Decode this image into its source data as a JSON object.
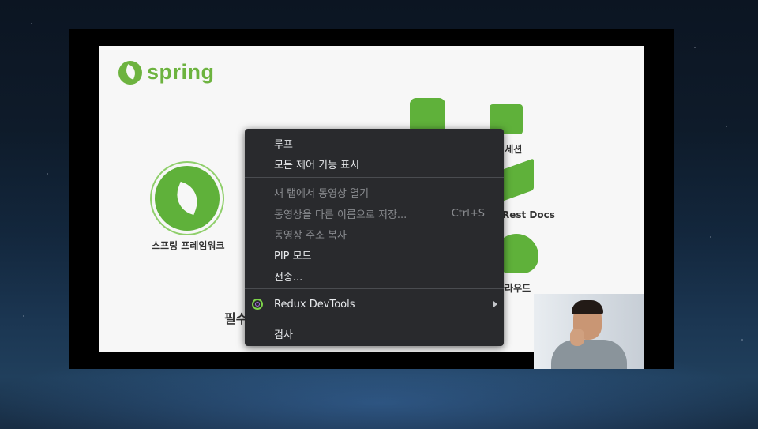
{
  "slide": {
    "logo_text": "spring",
    "framework_label": "스프링 프레임워크",
    "session_label": "링 세션",
    "docs_label": "Rest Docs",
    "cloud_label": "클라우드",
    "bottom_text": "필수"
  },
  "context_menu": {
    "items": [
      {
        "label": "루프",
        "enabled": true
      },
      {
        "label": "모든 제어 기능 표시",
        "enabled": true
      },
      {
        "label": "새 탭에서 동영상 열기",
        "enabled": false
      },
      {
        "label": "동영상을 다른 이름으로 저장...",
        "shortcut": "Ctrl+S",
        "enabled": false
      },
      {
        "label": "동영상 주소 복사",
        "enabled": false
      },
      {
        "label": "PIP 모드",
        "enabled": true
      },
      {
        "label": "전송...",
        "enabled": true
      },
      {
        "label": "Redux DevTools",
        "icon": "redux-icon",
        "submenu": true,
        "enabled": true
      },
      {
        "label": "검사",
        "enabled": true
      }
    ]
  },
  "colors": {
    "spring_green": "#6db33f",
    "menu_bg": "#292a2d",
    "menu_text": "#e8eaed",
    "menu_disabled_text": "#8a8c90"
  }
}
